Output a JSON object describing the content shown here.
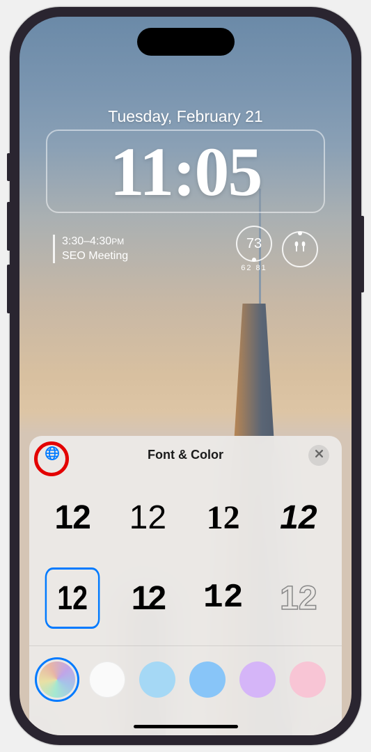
{
  "lockscreen": {
    "date": "Tuesday, February 21",
    "time": "11:05",
    "calendar": {
      "time_start": "3:30",
      "time_end": "4:30",
      "period": "PM",
      "title": "SEO Meeting"
    },
    "weather": {
      "temp": "73",
      "low": "62",
      "high": "81"
    }
  },
  "panel": {
    "title": "Font & Color",
    "font_sample": "12",
    "fonts": [
      {
        "id": 1,
        "selected": false
      },
      {
        "id": 2,
        "selected": false
      },
      {
        "id": 3,
        "selected": false
      },
      {
        "id": 4,
        "selected": false
      },
      {
        "id": 5,
        "selected": true
      },
      {
        "id": 6,
        "selected": false
      },
      {
        "id": 7,
        "selected": false
      },
      {
        "id": 8,
        "selected": false
      }
    ],
    "colors": [
      {
        "name": "multicolor-gradient",
        "hex": "gradient",
        "selected": true
      },
      {
        "name": "white",
        "hex": "#fafafa",
        "selected": false
      },
      {
        "name": "light-blue",
        "hex": "#a5d8f5",
        "selected": false
      },
      {
        "name": "sky-blue",
        "hex": "#88c5f8",
        "selected": false
      },
      {
        "name": "lavender",
        "hex": "#d5b5f8",
        "selected": false
      },
      {
        "name": "pink",
        "hex": "#f8c5d5",
        "selected": false
      }
    ]
  },
  "annotation": {
    "target": "globe-language-button",
    "style": "red-circle"
  }
}
